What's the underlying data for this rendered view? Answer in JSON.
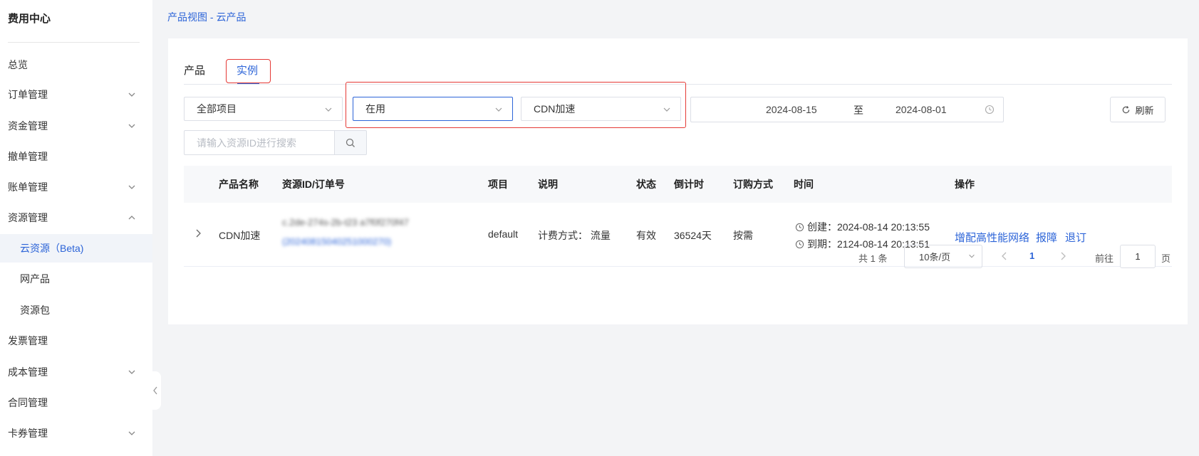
{
  "sidebar": {
    "title": "费用中心",
    "items": [
      {
        "label": "总览"
      },
      {
        "label": "订单管理"
      },
      {
        "label": "资金管理"
      },
      {
        "label": "撤单管理"
      },
      {
        "label": "账单管理"
      },
      {
        "label": "资源管理"
      },
      {
        "label": "云资源（Beta)"
      },
      {
        "label": "网产品"
      },
      {
        "label": "资源包"
      },
      {
        "label": "发票管理"
      },
      {
        "label": "成本管理"
      },
      {
        "label": "合同管理"
      },
      {
        "label": "卡券管理"
      }
    ]
  },
  "breadcrumb": "产品视图 - 云产品",
  "tabs": [
    {
      "label": "产品"
    },
    {
      "label": "实例"
    }
  ],
  "filters": {
    "project": "全部项目",
    "status": "在用",
    "product": "CDN加速",
    "date_start": "2024-08-15",
    "date_sep": "至",
    "date_end": "2024-08-01",
    "refresh_label": "刷新",
    "search_placeholder": "请输入资源ID进行搜索"
  },
  "table": {
    "columns": [
      "产品名称",
      "资源ID/订单号",
      "项目",
      "说明",
      "状态",
      "倒计时",
      "订购方式",
      "时间",
      "操作"
    ],
    "rows": [
      {
        "product": "CDN加速",
        "resource_id": "c.2de-274s-2b-t23                    a7f0f270f47",
        "order_no": "(20240815040251000270)",
        "project": "default",
        "description": "计费方式：  流量",
        "status": "有效",
        "countdown": "36524天",
        "order_type": "按需",
        "created": "创建：2024-08-14 20:13:55",
        "expires": "到期：2124-08-14 20:13:51",
        "actions": [
          "增配高性能网络",
          "报障",
          "退订"
        ]
      }
    ]
  },
  "pagination": {
    "total": "共 1 条",
    "page_size": "10条/页",
    "current": "1",
    "goto_label": "前往",
    "goto_value": "1",
    "page_suffix": "页"
  },
  "colors": {
    "accent": "#2c64d8",
    "highlight_box": "#e53935"
  }
}
